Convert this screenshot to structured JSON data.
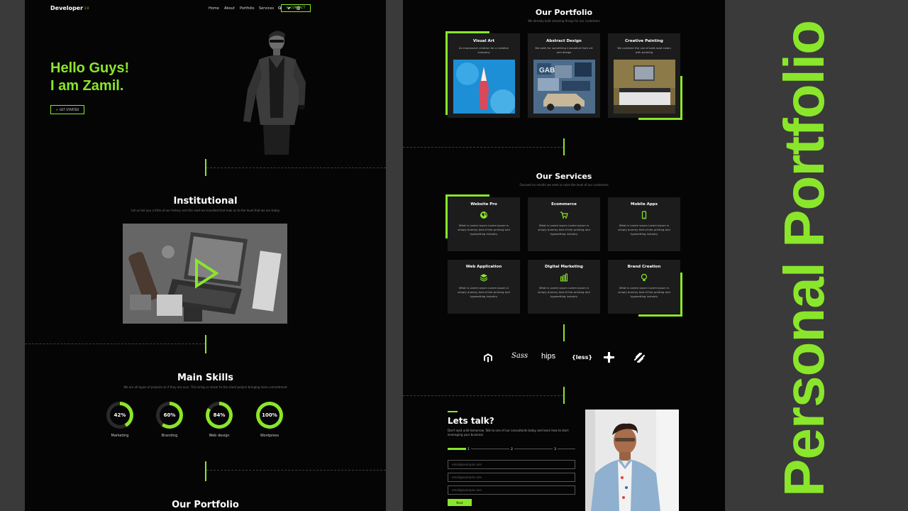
{
  "left_page": {
    "logo": "Developer",
    "logo_version": "2.0",
    "nav": [
      "Home",
      "About",
      "Portfolio",
      "Services"
    ],
    "contact_label": "CONTACT",
    "hero_line1": "Hello Guys!",
    "hero_line2": "I am Zamil.",
    "get_started_label": "GET STARTED",
    "institutional_title": "Institutional",
    "institutional_sub": "Let us tell you a little of our history and the road we travelled that took us to the level that we are today",
    "skills_title": "Main Skills",
    "skills_sub": "We are all types of projects as if they are ours. This bring us closer to the client project bringing more commitment",
    "skills": [
      {
        "value": "42%",
        "label": "Marketing",
        "percent": 42
      },
      {
        "value": "60%",
        "label": "Branding",
        "percent": 60
      },
      {
        "value": "84%",
        "label": "Web design",
        "percent": 84
      },
      {
        "value": "100%",
        "label": "Wordpress",
        "percent": 100
      }
    ],
    "portfolio_title": "Our Portfolio"
  },
  "right_page": {
    "portfolio_title": "Our Portfolio",
    "portfolio_sub": "We already built amazing things for our customers",
    "portfolio": [
      {
        "title": "Visual Art",
        "desc": "An impressive creation for a creative company"
      },
      {
        "title": "Abstract Design",
        "desc": "We seek for something innovative from art and design"
      },
      {
        "title": "Creative Painting",
        "desc": "We combine the use of bold-road colors with painting"
      }
    ],
    "services_title": "Our Services",
    "services_sub": "Focused on results we seek to raise the level of our customers",
    "services": [
      {
        "title": "Website Pro",
        "icon": "globe-icon"
      },
      {
        "title": "Ecommerce",
        "icon": "cart-icon"
      },
      {
        "title": "Mobile Apps",
        "icon": "mobile-icon"
      },
      {
        "title": "Web Application",
        "icon": "layers-icon"
      },
      {
        "title": "Digital Marketing",
        "icon": "chart-icon"
      },
      {
        "title": "Brand Creation",
        "icon": "lightbulb-icon"
      }
    ],
    "service_desc_1": "What is Lorem ipsum Lorem Ipsum is",
    "service_desc_2": "simply dummy text of the printing and",
    "service_desc_3": "typesetting industry",
    "brands": [
      "hips",
      "{less}"
    ],
    "talk_title": "Lets talk?",
    "talk_desc": "Don't wait until tomorrow. Talk to one of our consultants today and learn how to start leveraging your business",
    "steps": [
      "1",
      "2",
      "3"
    ],
    "field_placeholder": "email@example.com",
    "send_label": "Next"
  },
  "side_title": "Personal Portfolio",
  "colors": {
    "accent": "#8ae62a",
    "bg": "#050505",
    "card": "#1c1c1c",
    "frame": "#3a3a3a"
  }
}
